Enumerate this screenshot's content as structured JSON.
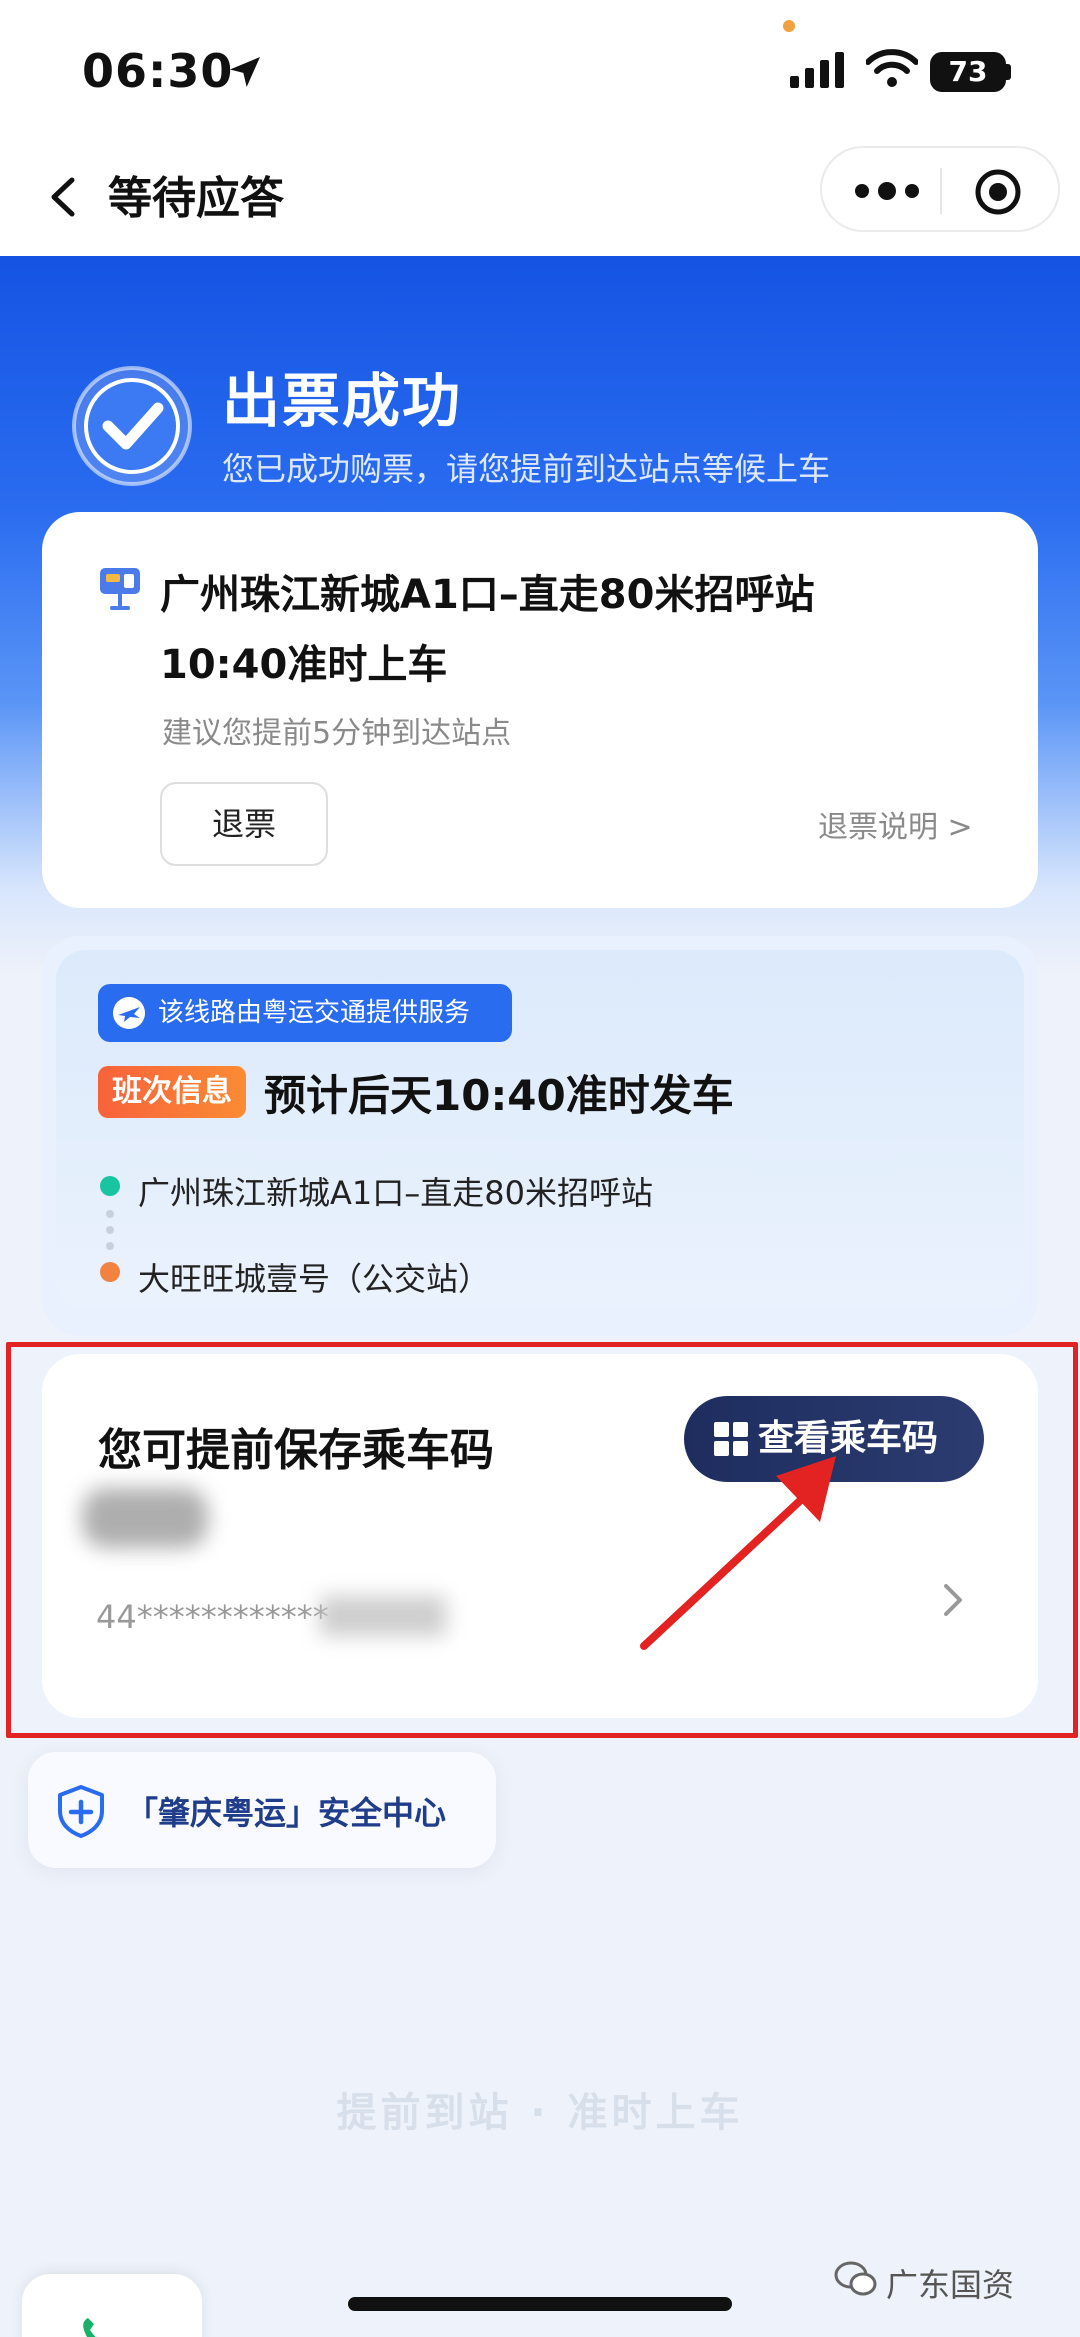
{
  "status_bar": {
    "time": "06:30",
    "battery": "73"
  },
  "nav": {
    "title": "等待应答"
  },
  "hero": {
    "title": "出票成功",
    "subtitle": "您已成功购票，请您提前到达站点等候上车"
  },
  "ticket_card": {
    "station": "广州珠江新城A1口–直走80米招呼站",
    "boarding_time": "10:40准时上车",
    "hint": "建议您提前5分钟到达站点",
    "refund_button": "退票",
    "refund_info": "退票说明 >"
  },
  "trip_card": {
    "operator_badge": "该线路由粤运交通提供服务",
    "trip_badge": "班次信息",
    "trip_title": "预计后天10:40准时发车",
    "from_stop": "广州珠江新城A1口–直走80米招呼站",
    "to_stop": "大旺旺城壹号（公交站）"
  },
  "ride_code_card": {
    "title": "您可提前保存乘车码",
    "button": "查看乘车码",
    "masked_id": "44************"
  },
  "safety": {
    "label": "「肇庆粤运」安全中心"
  },
  "slogan": "提前到站 · 准时上车",
  "watermark": "广东国资",
  "colors": {
    "primary_blue": "#1554e3",
    "annotation_red": "#e32222",
    "dark_navy": "#1e2d5e"
  }
}
